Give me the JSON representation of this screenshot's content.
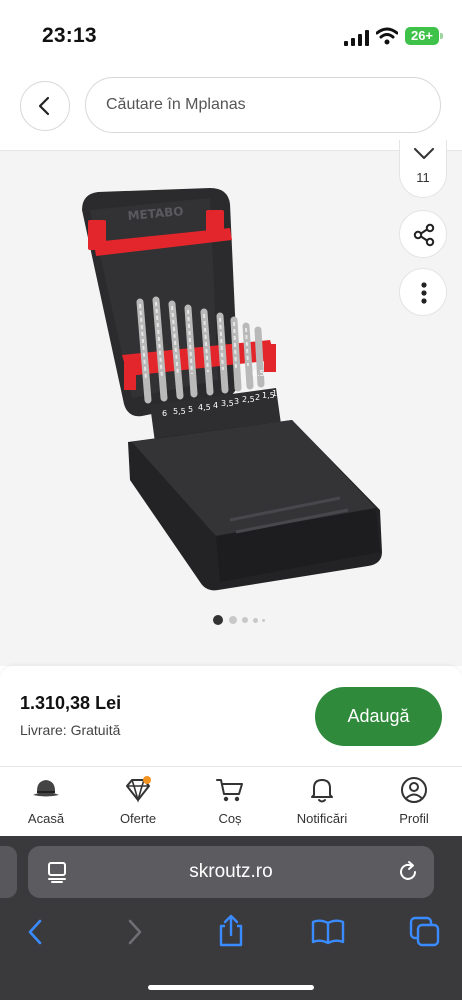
{
  "status_bar": {
    "time": "23:13",
    "battery": "26+"
  },
  "header": {
    "search_placeholder": "Căutare în Mplanas"
  },
  "product": {
    "favorites_count": "11",
    "image_dots": 5,
    "active_image": 1,
    "drill_sizes_top": [
      "6.5"
    ],
    "drill_sizes_bottom": [
      "6",
      "5,5",
      "5",
      "4,5",
      "4",
      "3,5",
      "3",
      "2,5",
      "2",
      "1,5",
      "1"
    ],
    "brand": "METABO"
  },
  "buy_bar": {
    "price": "1.310,38 Lei",
    "delivery": "Livrare: Gratuită",
    "add_label": "Adaugă"
  },
  "nav": {
    "items": [
      {
        "label": "Acasă",
        "icon": "home-hat-icon"
      },
      {
        "label": "Oferte",
        "icon": "diamond-icon"
      },
      {
        "label": "Coș",
        "icon": "cart-icon"
      },
      {
        "label": "Notificări",
        "icon": "bell-icon"
      },
      {
        "label": "Profil",
        "icon": "profile-icon"
      }
    ]
  },
  "browser": {
    "url": "skroutz.ro"
  },
  "colors": {
    "accent": "#2f8a3b",
    "offer_badge": "#f39321",
    "case_red": "#e3262b"
  }
}
